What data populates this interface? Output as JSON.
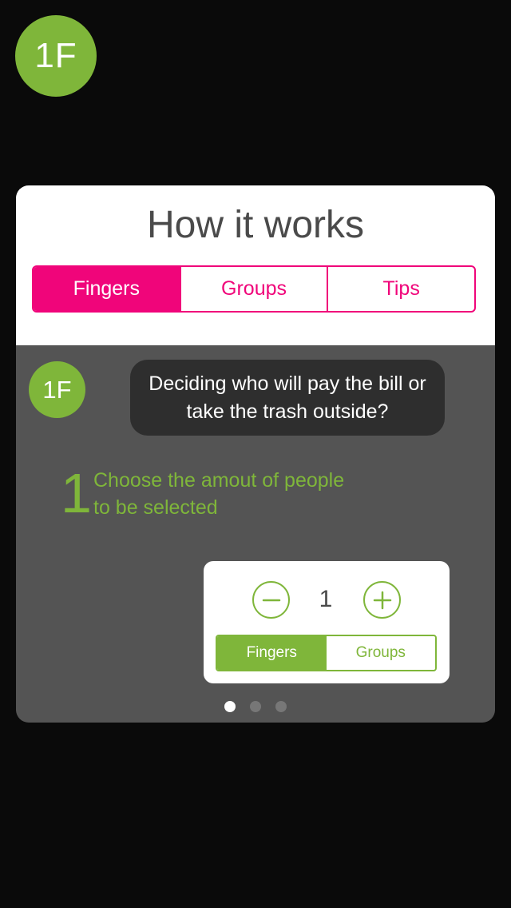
{
  "app": {
    "logo_text": "1F"
  },
  "card": {
    "title": "How it works",
    "tabs": [
      {
        "label": "Fingers",
        "selected": true
      },
      {
        "label": "Groups",
        "selected": false
      },
      {
        "label": "Tips",
        "selected": false
      }
    ]
  },
  "slide": {
    "logo_text": "1F",
    "bubble_text": "Deciding who will pay the bill or take the trash outside?",
    "step_number": "1",
    "step_text": "Choose the amout of people to be selected",
    "widget": {
      "value": "1",
      "minus_icon": "minus-circle-icon",
      "plus_icon": "plus-circle-icon",
      "modes": [
        {
          "label": "Fingers",
          "selected": true
        },
        {
          "label": "Groups",
          "selected": false
        }
      ]
    }
  },
  "pagination": {
    "count": 3,
    "active_index": 0
  },
  "colors": {
    "accent_pink": "#f0057a",
    "accent_green": "#7fb63a",
    "background": "#0a0a0a",
    "card_dark": "#545454"
  }
}
